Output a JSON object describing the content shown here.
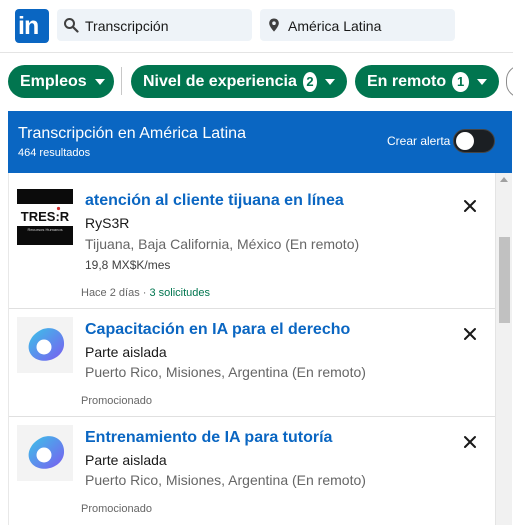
{
  "app": {
    "logo_text": "in",
    "brand_color": "#0a66c2",
    "accent_color": "#01754f"
  },
  "search": {
    "keyword": "Transcripción",
    "location": "América Latina",
    "keyword_icon": "search-icon",
    "location_icon": "location-pin-icon"
  },
  "filters": [
    {
      "label": "Empleos",
      "count": ""
    },
    {
      "label": "Nivel de experiencia",
      "count": "2"
    },
    {
      "label": "En remoto",
      "count": "1"
    }
  ],
  "results_header": {
    "title": "Transcripción en América Latina",
    "count": "464 resultados",
    "alert_label": "Crear alerta",
    "alert_enabled": false
  },
  "jobs": [
    {
      "title": "atención al cliente tijuana en línea",
      "company": "RyS3R",
      "location": "Tijuana, Baja California, México (En remoto)",
      "salary": "19,8 MX$K/mes",
      "posted": "Hace 2 días · ",
      "applicants": "3 solicitudes",
      "logo": "tresr-logo",
      "logo_text": "TRES:R",
      "logo_tagline": "Recursos Humanos"
    },
    {
      "title": "Capacitación en IA para el derecho",
      "company": "Parte aislada",
      "location": "Puerto Rico, Misiones, Argentina (En remoto)",
      "salary": "",
      "posted": "Promocionado",
      "applicants": "",
      "logo": "outlier-logo"
    },
    {
      "title": "Entrenamiento de IA para tutoría",
      "company": "Parte aislada",
      "location": "Puerto Rico, Misiones, Argentina (En remoto)",
      "salary": "",
      "posted": "Promocionado",
      "applicants": "",
      "logo": "outlier-logo"
    }
  ]
}
